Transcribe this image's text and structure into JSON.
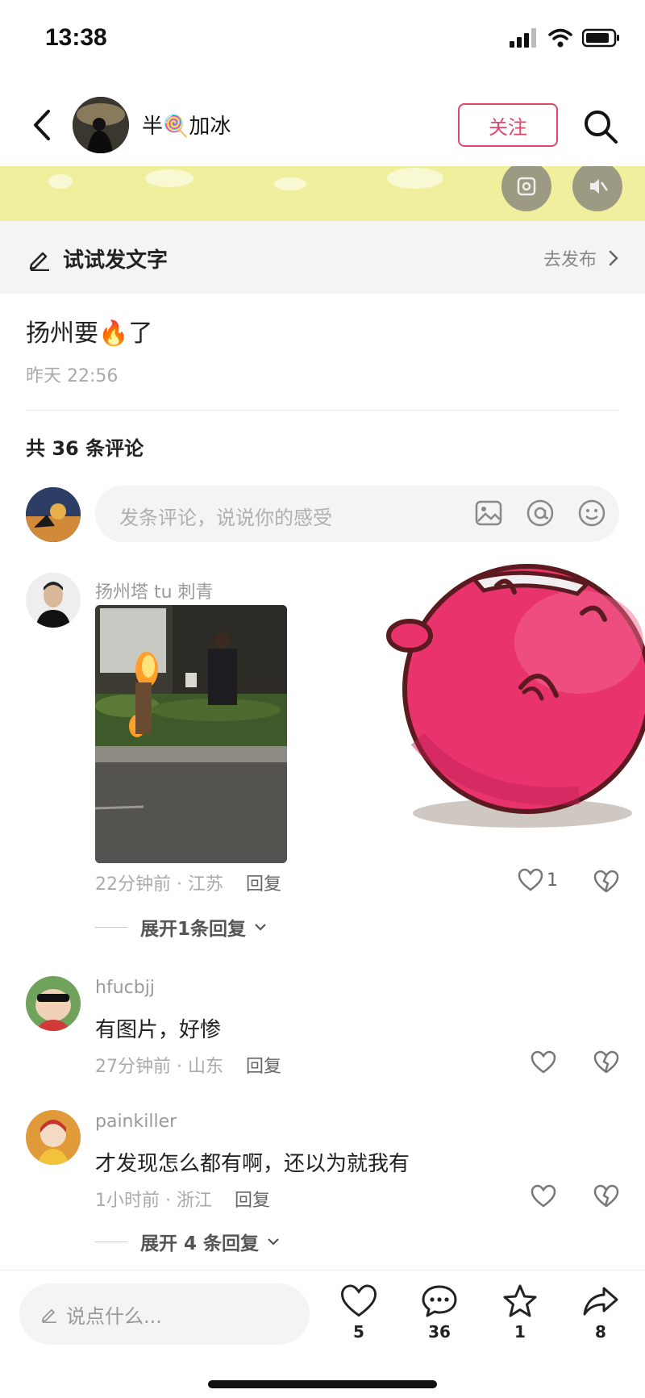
{
  "status_bar": {
    "time": "13:38"
  },
  "header": {
    "username": "半🍭加冰",
    "follow_label": "关注"
  },
  "compose": {
    "label": "试试发文字",
    "publish_label": "去发布"
  },
  "post": {
    "text": "扬州要🔥了",
    "time": "昨天 22:56"
  },
  "comments_count": "共 36 条评论",
  "comment_input": {
    "placeholder": "发条评论，说说你的感受"
  },
  "comments": [
    {
      "user": "扬州塔 tu 刺青",
      "text": "",
      "meta": "22分钟前 · 江苏",
      "reply_label": "回复",
      "likes": "1",
      "expand_label": "展开1条回复"
    },
    {
      "user": "hfucbjj",
      "text": "有图片，好惨",
      "meta": "27分钟前 · 山东",
      "reply_label": "回复",
      "likes": ""
    },
    {
      "user": "painkiller",
      "text": "才发现怎么都有啊，还以为就我有",
      "meta": "1小时前 · 浙江",
      "reply_label": "回复",
      "likes": "",
      "expand_label": "展开 4 条回复"
    }
  ],
  "bottom_bar": {
    "input_placeholder": "说点什么...",
    "like_count": "5",
    "comment_count": "36",
    "favorite_count": "1",
    "share_count": "8"
  },
  "colors": {
    "accent": "#e0466a",
    "banner": "#f0ef9e",
    "sticker": "#e8336d"
  }
}
